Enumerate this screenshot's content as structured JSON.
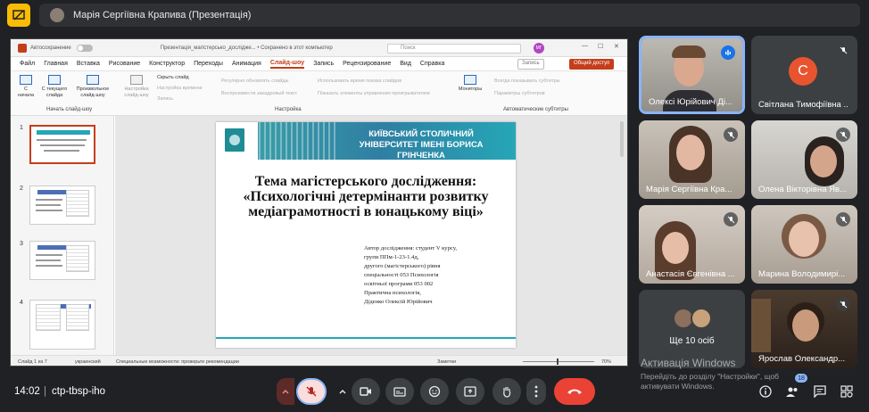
{
  "presenter_bar": {
    "title": "Марія Сергіївна Крапива (Презентація)"
  },
  "ppt": {
    "title_bar": {
      "autosave": "Автосохранение",
      "file": "Презентація_магістерсько_дослідже... • Сохранено в этот компьютер",
      "search_placeholder": "Поиск",
      "user_initials": "МГ"
    },
    "menu": [
      "Файл",
      "Главная",
      "Вставка",
      "Рисование",
      "Конструктор",
      "Переходы",
      "Анимация",
      "Слайд-шоу",
      "Запись",
      "Рецензирование",
      "Вид",
      "Справка"
    ],
    "record_label": "Запись",
    "share_label": "Общий доступ",
    "ribbon": {
      "from_start": "С начала",
      "from_current": "С текущего слайда",
      "custom": "Произвольное слайд-шоу",
      "setup": "Настройка слайд-шоу",
      "hide_slide": "Скрыть слайд",
      "timing": "Настройка времени",
      "record": "Запись",
      "opt1": "Регулярно обновлять слайды",
      "opt2": "Воспроизвести закадровый текст",
      "opt3": "Использовать время показа слайдов",
      "opt4": "Показать элементы управления проигрывателем",
      "monitors": "Мониторы",
      "subs1": "Всегда показывать субтитры",
      "subs2": "Параметры субтитров",
      "group_start": "Начать слайд-шоу",
      "group_setup": "Настройка",
      "group_subs": "Автоматические субтитры"
    },
    "slide": {
      "university": "КИЇВСЬКИЙ СТОЛИЧНИЙ УНІВЕРСИТЕТ ІМЕНІ БОРИСА ГРІНЧЕНКА",
      "topic": "Тема магістерського дослідження: «Психологічні детермінанти розвитку медіаграмотності в юнацькому віці»",
      "author": [
        "Автор дослідження: студент V курсу,",
        "групи ППм-1-23-1.4д,",
        "другого (магістерського) рівня",
        "спеціальності 053 Психологія",
        "освітньої програми 053 002",
        "Практична психологія,",
        "Діденко Олексій Юрійович"
      ]
    },
    "thumb_numbers": [
      "1",
      "2",
      "3",
      "4"
    ],
    "status": {
      "slide": "Слайд 1 из 7",
      "lang": "украинский",
      "access": "Специальные возможности: проверьте рекомендации",
      "notes": "Заметки",
      "zoom": "70%"
    }
  },
  "participants": [
    {
      "name": "Олексі Юрійович Ді..."
    },
    {
      "name": "Світлана Тимофіївна ...",
      "initial": "С"
    },
    {
      "name": "Марія Сергіївна Кра..."
    },
    {
      "name": "Олена Вікторівна Яв..."
    },
    {
      "name": "Анастасія Євгенівна ..."
    },
    {
      "name": "Марина Володимирі..."
    },
    {
      "more": "Ще 10 осіб"
    },
    {
      "name": "Ярослав Олександр..."
    }
  ],
  "watermark": {
    "title": "Активація Windows",
    "text": "Перейдіть до розділу \"Настройки\", щоб активувати Windows."
  },
  "bottom": {
    "time": "14:02",
    "separator": "|",
    "meeting_code": "ctp-tbsp-iho",
    "people_count": "18"
  },
  "colors": {
    "speaking_border": "#8ab4f8",
    "hangup": "#ea4335",
    "ppt_accent": "#c43e1c"
  }
}
